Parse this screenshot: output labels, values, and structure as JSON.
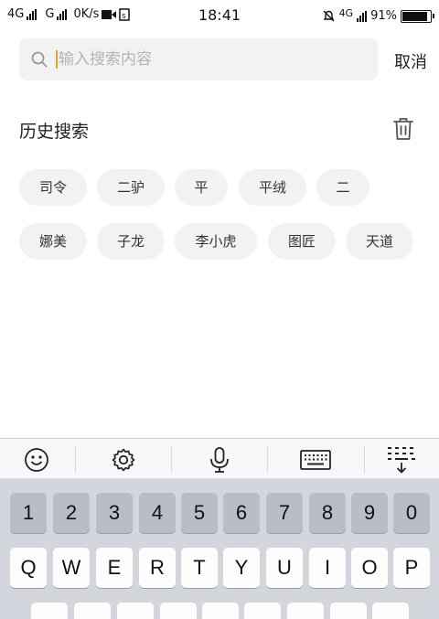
{
  "status_bar": {
    "sim1_label": "4G",
    "sim2_label": "G",
    "speed": "0K/s",
    "time": "18:41",
    "network_right": "4G",
    "battery": "91%"
  },
  "search": {
    "placeholder": "输入搜索内容",
    "cancel_label": "取消"
  },
  "history": {
    "title": "历史搜索",
    "tags": [
      "司令",
      "二驴",
      "平",
      "平绒",
      "二",
      "娜美",
      "子龙",
      "李小虎",
      "图匠",
      "天道"
    ]
  },
  "keyboard": {
    "number_row": [
      "1",
      "2",
      "3",
      "4",
      "5",
      "6",
      "7",
      "8",
      "9",
      "0"
    ],
    "letter_row": [
      "Q",
      "W",
      "E",
      "R",
      "T",
      "Y",
      "U",
      "I",
      "O",
      "P"
    ]
  },
  "colors": {
    "cursor": "#f0a020",
    "chip_bg": "#f2f2f2",
    "keyboard_bg": "#d3d6dc"
  }
}
